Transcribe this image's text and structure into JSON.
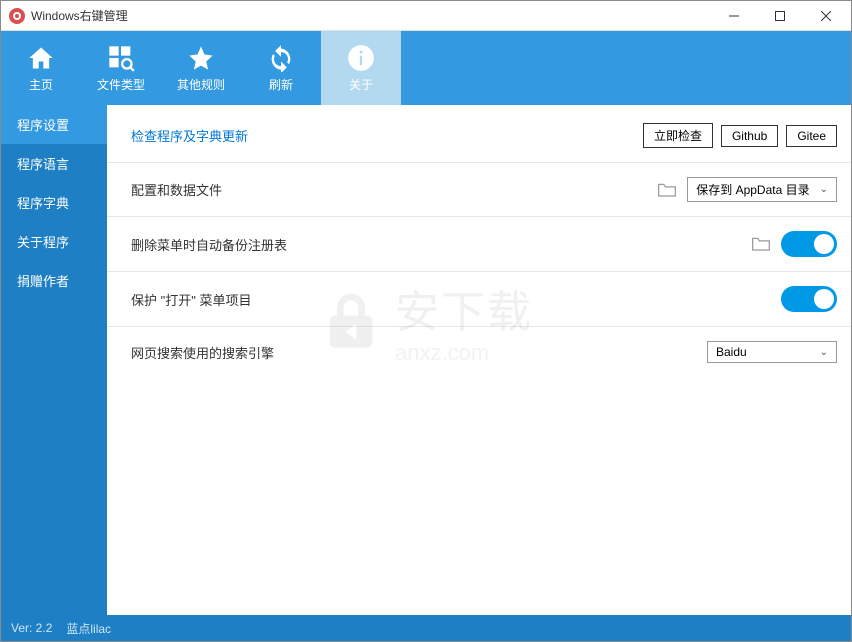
{
  "titlebar": {
    "title": "Windows右键管理"
  },
  "toolbar": {
    "home": "主页",
    "filetype": "文件类型",
    "other": "其他规则",
    "refresh": "刷新",
    "about": "关于"
  },
  "sidebar": {
    "items": [
      {
        "label": "程序设置"
      },
      {
        "label": "程序语言"
      },
      {
        "label": "程序字典"
      },
      {
        "label": "关于程序"
      },
      {
        "label": "捐赠作者"
      }
    ]
  },
  "content": {
    "check_update": "检查程序及字典更新",
    "btn_check": "立即检查",
    "btn_github": "Github",
    "btn_gitee": "Gitee",
    "row_config": "配置和数据文件",
    "select_config": "保存到 AppData 目录",
    "row_backup": "删除菜单时自动备份注册表",
    "row_protect": "保护 \"打开\" 菜单项目",
    "row_search": "网页搜索使用的搜索引擎",
    "select_search": "Baidu"
  },
  "statusbar": {
    "version": "Ver: 2.2",
    "author": "蓝点lilac"
  },
  "watermark": {
    "main": "安下载",
    "sub": "anxz.com"
  }
}
